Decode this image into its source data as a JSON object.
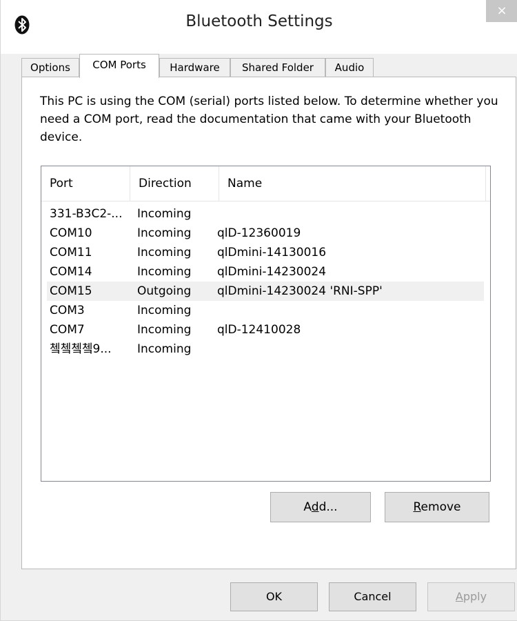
{
  "window": {
    "title": "Bluetooth Settings",
    "close_glyph": "×",
    "app_icon": "bluetooth-icon"
  },
  "tabs": [
    {
      "label": "Options",
      "active": false
    },
    {
      "label": "COM Ports",
      "active": true
    },
    {
      "label": "Hardware",
      "active": false
    },
    {
      "label": "Shared Folder",
      "active": false
    },
    {
      "label": "Audio",
      "active": false
    }
  ],
  "description": "This PC is using the COM (serial) ports listed below. To determine whether you need a COM port, read the documentation that came with your Bluetooth device.",
  "list": {
    "columns": [
      "Port",
      "Direction",
      "Name"
    ],
    "rows": [
      {
        "port": "331-B3C2-...",
        "direction": "Incoming",
        "name": ""
      },
      {
        "port": "COM10",
        "direction": "Incoming",
        "name": "qlD-12360019"
      },
      {
        "port": "COM11",
        "direction": "Incoming",
        "name": "qlDmini-14130016"
      },
      {
        "port": "COM14",
        "direction": "Incoming",
        "name": "qlDmini-14230024"
      },
      {
        "port": "COM15",
        "direction": "Outgoing",
        "name": "qlDmini-14230024 'RNI-SPP'"
      },
      {
        "port": "COM3",
        "direction": "Incoming",
        "name": ""
      },
      {
        "port": "COM7",
        "direction": "Incoming",
        "name": "qlD-12410028"
      },
      {
        "port": "쳌쳌쳌쳌9...",
        "direction": "Incoming",
        "name": ""
      }
    ],
    "selected_row": 4
  },
  "buttons": {
    "add": {
      "pre": "A",
      "key": "d",
      "post": "d..."
    },
    "remove": {
      "pre": "",
      "key": "R",
      "post": "emove"
    },
    "ok": "OK",
    "cancel": "Cancel",
    "apply": {
      "pre": "",
      "key": "A",
      "post": "pply"
    }
  },
  "colors": {
    "selected_row": "#f0f0f0",
    "dialog_bg": "#f0f0f0",
    "close_button": "#c7c7c7"
  }
}
